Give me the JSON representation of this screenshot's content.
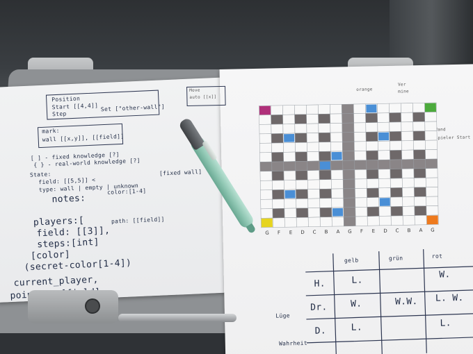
{
  "notes": {
    "box1": [
      "Position",
      "Start [[4,4]]",
      "Step",
      "Set [\"other-wall\"]"
    ],
    "box2": [
      "mark:",
      "wall [[x,y]], [[field]]"
    ],
    "lines": [
      "[ ] - fixed knowledge [?]",
      "{ } - real-world knowledge [?]",
      "State:",
      "field: [[5,5]] <",
      "type: wall | empty | unknown",
      "[fixed wall]",
      "notes:",
      "color:[1-4]",
      "players:[",
      "field: [[3]],",
      "path: [[field]]",
      "steps:[int]",
      "[color]",
      "(secret-color[1-4])",
      "current_player,",
      "pointer: [field]"
    ]
  },
  "grid_page": {
    "header_left": [
      "Move",
      "auto [[x]]"
    ],
    "header_right": [
      "Ver",
      "mine"
    ],
    "legend": [
      "+ Wand",
      "S Spieler Start"
    ],
    "color_word": "orange",
    "columns": [
      "G",
      "F",
      "E",
      "D",
      "C",
      "B",
      "A"
    ]
  },
  "score_table": {
    "headers": [
      "gelb",
      "grün",
      "rot"
    ],
    "rows": [
      {
        "label": "H.",
        "cells": [
          "L.",
          "",
          "W."
        ]
      },
      {
        "label": "Dr.",
        "cells": [
          "W.",
          "W.W.",
          "L. W."
        ]
      },
      {
        "label": "D.",
        "cells": [
          "L.",
          "",
          "L."
        ]
      }
    ],
    "side_labels": [
      "Lüge",
      "Wahrheit"
    ]
  },
  "colors": {
    "ink": "#1f2a44",
    "corner_magenta": "#b0307a",
    "corner_green": "#4caa3c",
    "corner_yellow": "#e6d41e",
    "corner_orange": "#ee7a1e",
    "marker_blue": "#4a8fd6",
    "wall_gray": "#8a8587",
    "cell_gray": "#6e6869"
  }
}
